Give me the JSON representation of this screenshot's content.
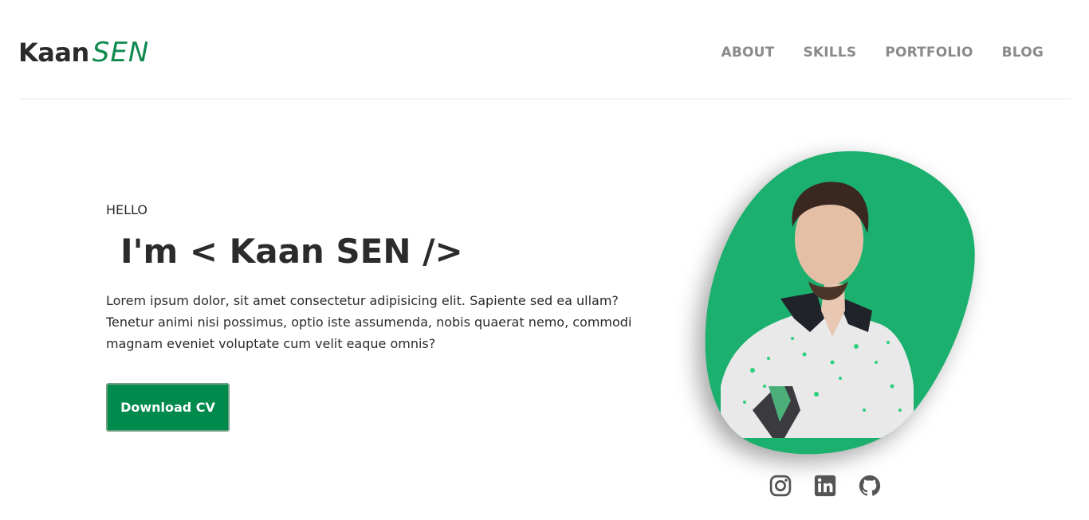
{
  "header": {
    "logo_first": "Kaan",
    "logo_second": "SEN",
    "nav": [
      {
        "label": "ABOUT"
      },
      {
        "label": "SKILLS"
      },
      {
        "label": "PORTFOLIO"
      },
      {
        "label": "BLOG"
      }
    ]
  },
  "hero": {
    "greeting": "HELLO",
    "headline": "I'm < Kaan SEN />",
    "description": "Lorem ipsum dolor, sit amet consectetur adipisicing elit. Sapiente sed ea ullam? Tenetur animi nisi possimus, optio iste assumenda, nobis quaerat nemo, commodi magnam eveniet voluptate cum velit eaque omnis?",
    "cta_label": "Download CV"
  },
  "socials": [
    {
      "icon": "instagram-icon"
    },
    {
      "icon": "linkedin-icon"
    },
    {
      "icon": "github-icon"
    }
  ],
  "colors": {
    "accent": "#0f8a4f",
    "button": "#008a4c",
    "blob": "#1cb06e",
    "nav_text": "#8a8a8a",
    "icon": "#555555"
  }
}
